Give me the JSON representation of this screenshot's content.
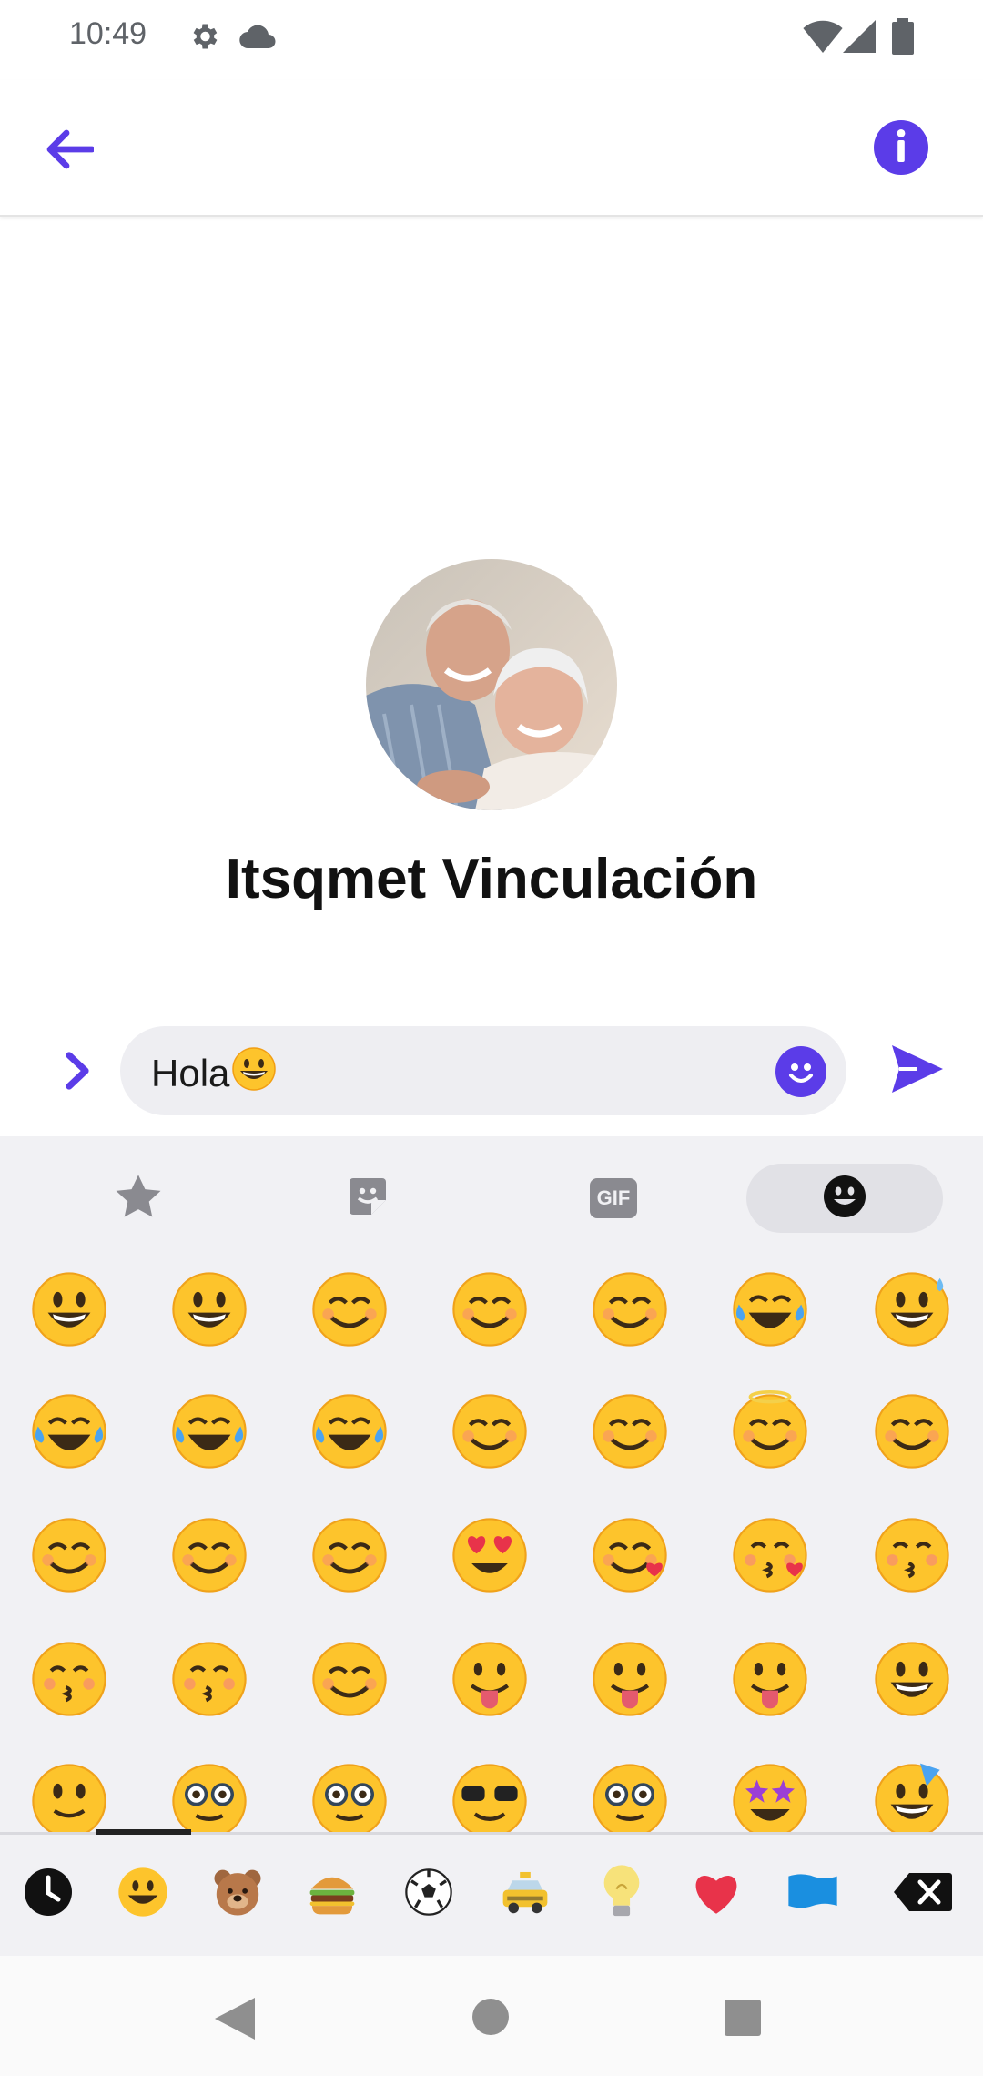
{
  "status_bar": {
    "time": "10:49",
    "icons": [
      "gear-icon",
      "cloud-icon",
      "wifi-icon",
      "signal-icon",
      "battery-icon"
    ]
  },
  "app_bar": {
    "back_icon": "arrow-left-icon",
    "info_icon": "info-icon",
    "accent_color": "#5b3ce8"
  },
  "conversation": {
    "avatar_alt": "contact-avatar-photo",
    "contact_name": "Itsqmet Vinculación"
  },
  "composer": {
    "expand_icon": "chevron-right-icon",
    "message_text": "Hola",
    "message_emoji": "grinning-face",
    "emoji_button_icon": "smiley-icon",
    "send_icon": "send-icon"
  },
  "emoji_panel": {
    "tabs": [
      {
        "icon": "star-icon",
        "active": false
      },
      {
        "icon": "sticker-icon",
        "active": false
      },
      {
        "icon": "gif-icon",
        "label": "GIF",
        "active": false
      },
      {
        "icon": "emoji-icon",
        "active": true
      }
    ],
    "emoji_rows": [
      [
        "grinning-face",
        "grinning-face-big-eyes",
        "grinning-face-smiling-eyes",
        "beaming-face",
        "grinning-squinting-face",
        "face-holding-back-tears",
        "grinning-face-sweat"
      ],
      [
        "face-tears-of-joy",
        "rolling-on-floor-laughing",
        "smiling-face-with-tear",
        "smiling-face",
        "smiling-face-smiling-eyes",
        "smiling-face-halo",
        "slightly-smiling-face"
      ],
      [
        "upside-down-face",
        "winking-face",
        "relieved-face",
        "smiling-face-heart-eyes",
        "smiling-face-hearts",
        "face-blowing-kiss",
        "kissing-face"
      ],
      [
        "kissing-face-closed-eyes",
        "kissing-face-smiling-eyes",
        "face-savoring-food",
        "face-with-tongue",
        "squinting-face-tongue",
        "winking-face-tongue",
        "zany-face"
      ],
      [
        "face-raised-eyebrow",
        "face-monocle",
        "nerd-face",
        "smiling-face-sunglasses",
        "disguised-face",
        "star-struck",
        "partying-face"
      ]
    ],
    "categories": [
      "clock-icon",
      "smiley-category-icon",
      "bear-icon",
      "burger-icon",
      "soccer-ball-icon",
      "taxi-icon",
      "lightbulb-icon",
      "heart-icon",
      "flag-icon"
    ],
    "delete_icon": "backspace-icon"
  },
  "nav_bar": {
    "icons": [
      "back-triangle-icon",
      "home-circle-icon",
      "recents-square-icon"
    ]
  }
}
